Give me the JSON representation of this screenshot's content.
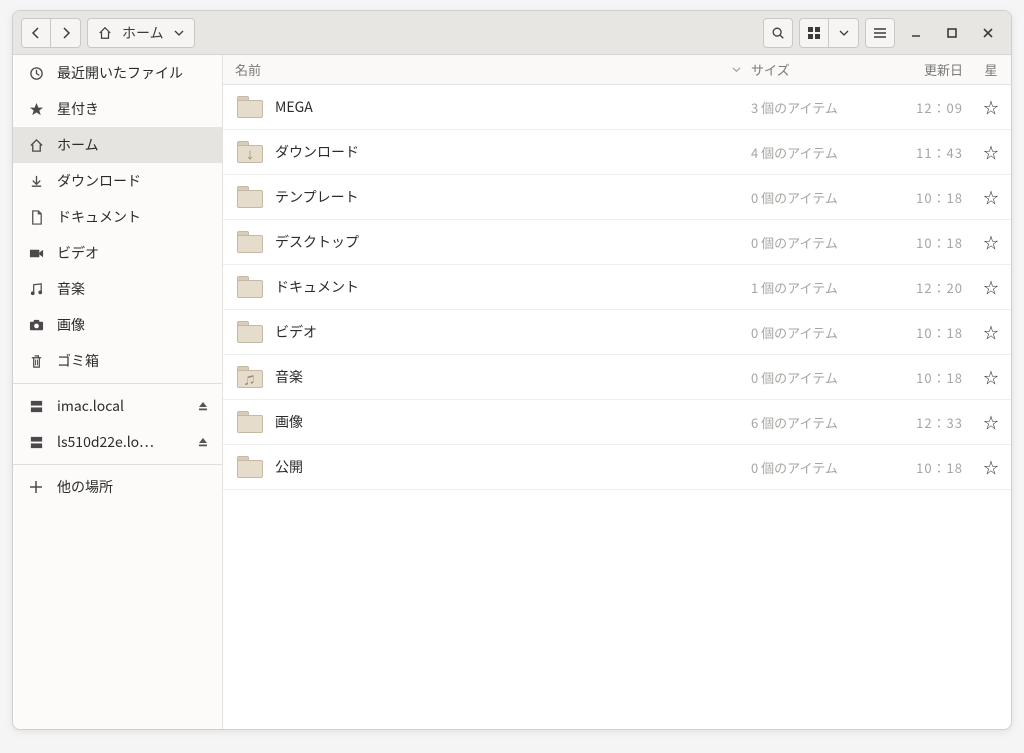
{
  "toolbar": {
    "path_label": "ホーム"
  },
  "columns": {
    "name": "名前",
    "size": "サイズ",
    "date": "更新日",
    "star": "星"
  },
  "sidebar": {
    "recent": "最近開いたファイル",
    "starred": "星付き",
    "home": "ホーム",
    "downloads": "ダウンロード",
    "documents": "ドキュメント",
    "videos": "ビデオ",
    "music": "音楽",
    "pictures": "画像",
    "trash": "ゴミ箱",
    "net1": "imac.local",
    "net2": "ls510d22e.lo…",
    "other": "他の場所"
  },
  "rows": [
    {
      "name": "MEGA",
      "size": "3 個のアイテム",
      "date": "12：09",
      "glyph": ""
    },
    {
      "name": "ダウンロード",
      "size": "4 個のアイテム",
      "date": "11：43",
      "glyph": "↓"
    },
    {
      "name": "テンプレート",
      "size": "0 個のアイテム",
      "date": "10：18",
      "glyph": ""
    },
    {
      "name": "デスクトップ",
      "size": "0 個のアイテム",
      "date": "10：18",
      "glyph": ""
    },
    {
      "name": "ドキュメント",
      "size": "1 個のアイテム",
      "date": "12：20",
      "glyph": ""
    },
    {
      "name": "ビデオ",
      "size": "0 個のアイテム",
      "date": "10：18",
      "glyph": ""
    },
    {
      "name": "音楽",
      "size": "0 個のアイテム",
      "date": "10：18",
      "glyph": "♫"
    },
    {
      "name": "画像",
      "size": "6 個のアイテム",
      "date": "12：33",
      "glyph": ""
    },
    {
      "name": "公開",
      "size": "0 個のアイテム",
      "date": "10：18",
      "glyph": ""
    }
  ]
}
